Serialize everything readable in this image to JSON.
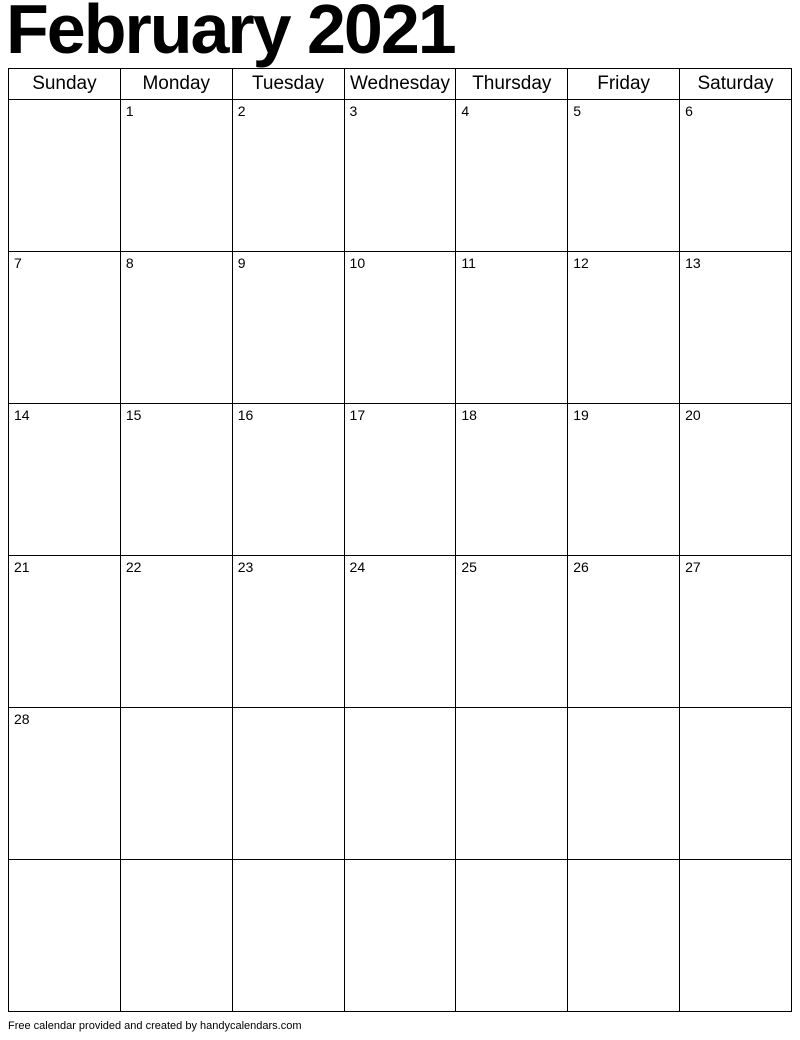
{
  "title": "February 2021",
  "dayHeaders": [
    "Sunday",
    "Monday",
    "Tuesday",
    "Wednesday",
    "Thursday",
    "Friday",
    "Saturday"
  ],
  "weeks": [
    [
      "",
      "1",
      "2",
      "3",
      "4",
      "5",
      "6"
    ],
    [
      "7",
      "8",
      "9",
      "10",
      "11",
      "12",
      "13"
    ],
    [
      "14",
      "15",
      "16",
      "17",
      "18",
      "19",
      "20"
    ],
    [
      "21",
      "22",
      "23",
      "24",
      "25",
      "26",
      "27"
    ],
    [
      "28",
      "",
      "",
      "",
      "",
      "",
      ""
    ],
    [
      "",
      "",
      "",
      "",
      "",
      "",
      ""
    ]
  ],
  "footer": "Free calendar provided and created by handycalendars.com"
}
